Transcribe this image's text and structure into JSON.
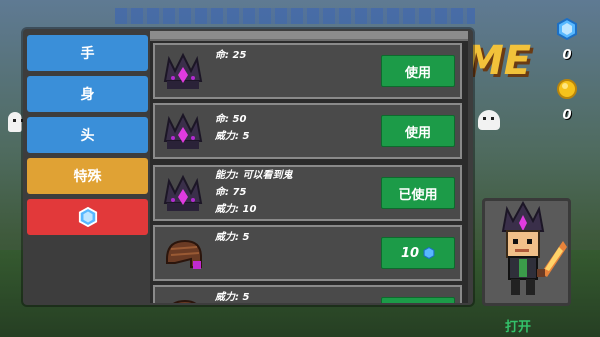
{
  "top_banner": "",
  "background": {
    "title_fragment": "ME",
    "under_button_text": "打开"
  },
  "currency": {
    "gems": "0",
    "coins": "0"
  },
  "categories": [
    {
      "label": "手"
    },
    {
      "label": "身"
    },
    {
      "label": "头"
    },
    {
      "label": "特殊"
    },
    {
      "label": "",
      "icon": "gem-icon"
    }
  ],
  "items": [
    {
      "stats": [
        "命: 25"
      ],
      "button": "使用",
      "icon": "crown-icon"
    },
    {
      "stats": [
        "命: 50",
        "威力: 5"
      ],
      "button": "使用",
      "icon": "crown-icon"
    },
    {
      "stats": [
        "能力: 可以看到鬼",
        "命: 75",
        "威力: 10"
      ],
      "button": "已使用",
      "icon": "crown-icon"
    },
    {
      "stats": [
        "威力: 5"
      ],
      "button": "10",
      "icon": "helmet-icon"
    },
    {
      "stats": [
        "威力: 5"
      ],
      "button": "",
      "icon": "helmet-icon"
    }
  ],
  "colors": {
    "green_button": "#1c9b48",
    "blue_tab": "#3a8fd9",
    "orange_tab": "#e0a234",
    "red_tab": "#e2393a"
  }
}
